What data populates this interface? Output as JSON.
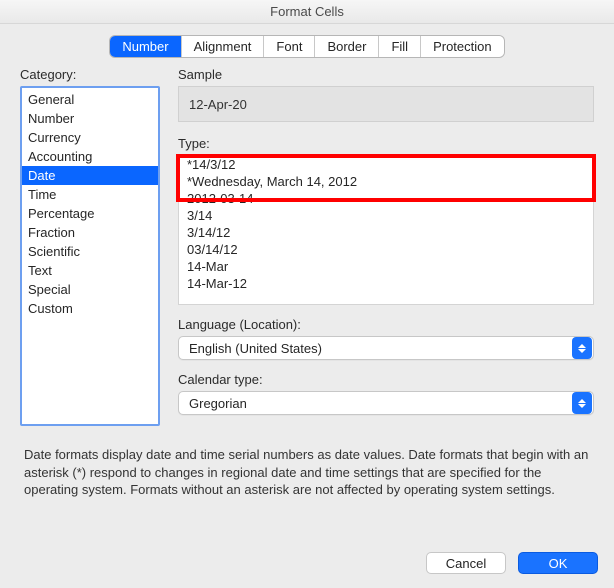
{
  "title": "Format Cells",
  "tabs": {
    "number": "Number",
    "alignment": "Alignment",
    "font": "Font",
    "border": "Border",
    "fill": "Fill",
    "protection": "Protection"
  },
  "labels": {
    "category": "Category:",
    "sample": "Sample",
    "type": "Type:",
    "language": "Language (Location):",
    "calendar": "Calendar type:"
  },
  "categories": {
    "general": "General",
    "number": "Number",
    "currency": "Currency",
    "accounting": "Accounting",
    "date": "Date",
    "time": "Time",
    "percentage": "Percentage",
    "fraction": "Fraction",
    "scientific": "Scientific",
    "text": "Text",
    "special": "Special",
    "custom": "Custom"
  },
  "sample_value": "12-Apr-20",
  "types": {
    "t0": "*14/3/12",
    "t1": "*Wednesday, March 14, 2012",
    "t2": "2012-03-14",
    "t3": "3/14",
    "t4": "3/14/12",
    "t5": "03/14/12",
    "t6": "14-Mar",
    "t7": "14-Mar-12"
  },
  "language_value": "English (United States)",
  "calendar_value": "Gregorian",
  "description": "Date formats display date and time serial numbers as date values.  Date formats that begin with an asterisk (*) respond to changes in regional date and time settings that are specified for the operating system. Formats without an asterisk are not affected by operating system settings.",
  "buttons": {
    "cancel": "Cancel",
    "ok": "OK"
  }
}
